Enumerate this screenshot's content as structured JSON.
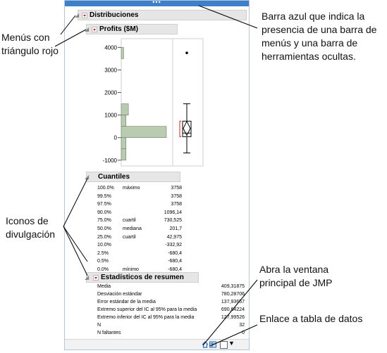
{
  "window": {
    "topbar_dots": "•••"
  },
  "distribuciones": {
    "title": "Distribuciones"
  },
  "profits": {
    "title": "Profits ($M)"
  },
  "chart_data": {
    "type": "bar",
    "orientation": "horizontal-histogram",
    "y_ticks": [
      "4000",
      "3000",
      "2000",
      "1000",
      "0",
      "-1000"
    ],
    "ylim": [
      -1100,
      4200
    ],
    "bins": [
      {
        "from": 3500,
        "to": 4000,
        "count": 1
      },
      {
        "from": 1000,
        "to": 1500,
        "count": 3
      },
      {
        "from": 500,
        "to": 1000,
        "count": 2
      },
      {
        "from": 0,
        "to": 500,
        "count": 19
      },
      {
        "from": -500,
        "to": 0,
        "count": 2
      },
      {
        "from": -1000,
        "to": -500,
        "count": 2
      }
    ],
    "outlier": 3758,
    "box": {
      "min": -680.4,
      "q1": 42.975,
      "median": 201.7,
      "q3": 730.525,
      "max": 1500,
      "mean": 409.31875
    }
  },
  "cuantiles": {
    "title": "Cuantiles",
    "rows": [
      {
        "pct": "100.0%",
        "label": "máximo",
        "value": "3758"
      },
      {
        "pct": "99.5%",
        "label": "",
        "value": "3758"
      },
      {
        "pct": "97.5%",
        "label": "",
        "value": "3758"
      },
      {
        "pct": "90.0%",
        "label": "",
        "value": "1096,14"
      },
      {
        "pct": "75.0%",
        "label": "cuartil",
        "value": "730,525"
      },
      {
        "pct": "50.0%",
        "label": "mediana",
        "value": "201,7"
      },
      {
        "pct": "25.0%",
        "label": "cuartil",
        "value": "42,975"
      },
      {
        "pct": "10.0%",
        "label": "",
        "value": "-332,92"
      },
      {
        "pct": "2.5%",
        "label": "",
        "value": "-680,4"
      },
      {
        "pct": "0.5%",
        "label": "",
        "value": "-680,4"
      },
      {
        "pct": "0.0%",
        "label": "mínimo",
        "value": "-680,4"
      }
    ]
  },
  "resumen": {
    "title": "Estadísticos de resumen",
    "rows": [
      {
        "label": "Media",
        "value": "409,31875"
      },
      {
        "label": "Desviación estándar",
        "value": "780,28706"
      },
      {
        "label": "Error estándar de la media",
        "value": "137,93657"
      },
      {
        "label": "Extremo superior del IC al 95% para la media",
        "value": "690,64224"
      },
      {
        "label": "Extremo inferior del IC al 95% para la media",
        "value": "127,99526"
      },
      {
        "label": "N",
        "value": "32"
      },
      {
        "label": "N faltantes",
        "value": "0"
      }
    ]
  },
  "callouts": {
    "red_menus": [
      "Menús con",
      "triángulo rojo"
    ],
    "blue_bar": [
      "Barra azul que indica la",
      "presencia de una barra de",
      "menús y una barra de",
      "herramientas ocultas."
    ],
    "disclosure": [
      "Iconos de",
      "divulgación"
    ],
    "home": [
      "Abra la ventana",
      "principal de JMP"
    ],
    "data_table": [
      "Enlace a tabla de datos"
    ]
  },
  "colors": {
    "accent_blue": "#3d7fc8",
    "red_triangle": "#d0201e",
    "histogram_fill": "#b9cbb0"
  }
}
